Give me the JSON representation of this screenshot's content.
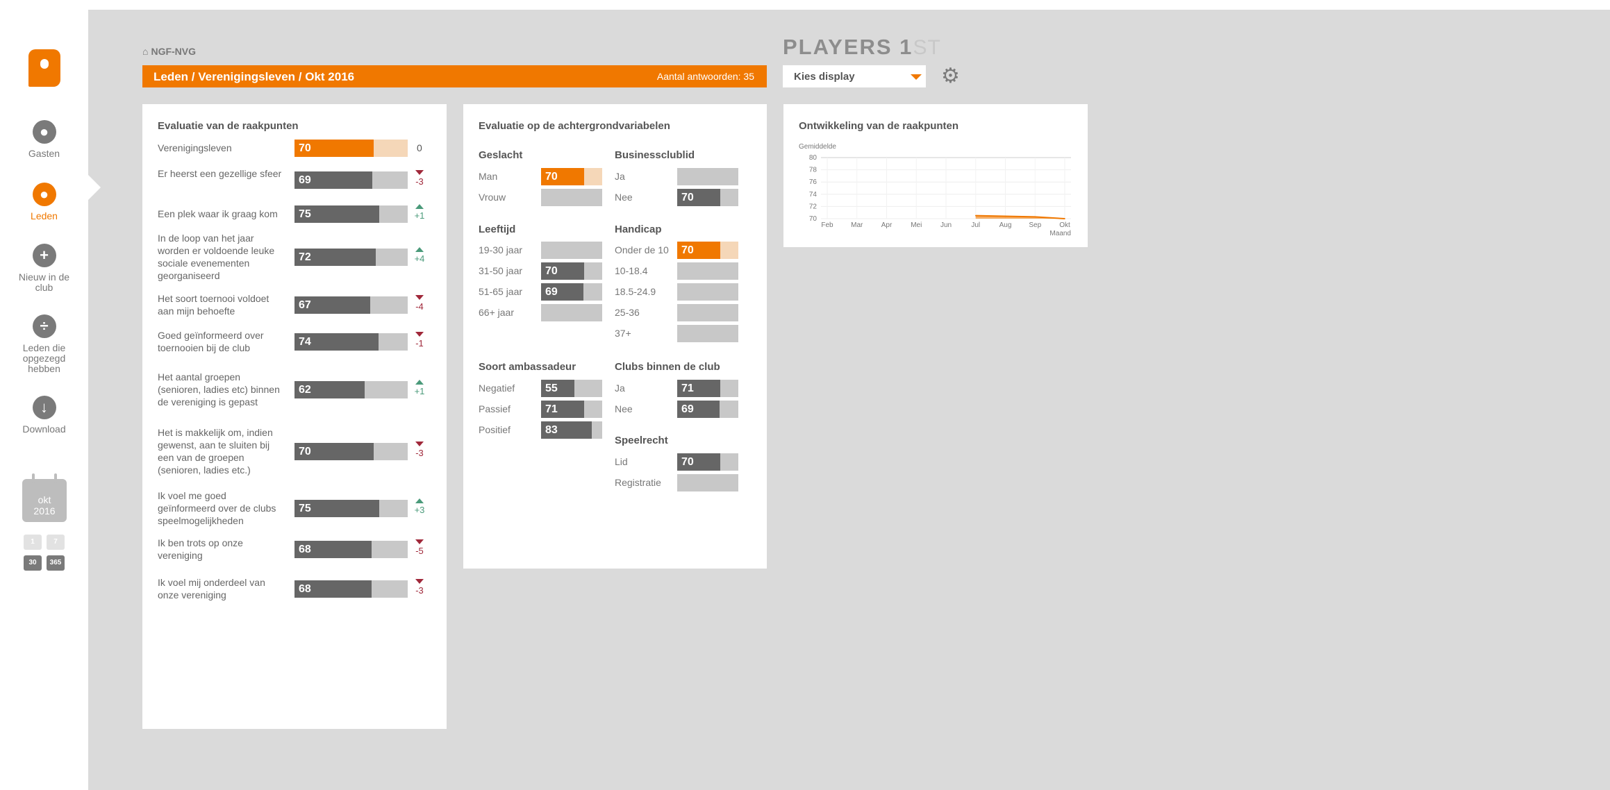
{
  "nav": {
    "items": [
      {
        "label": "Gasten",
        "icon": "person-icon",
        "glyph": "●"
      },
      {
        "label": "Leden",
        "icon": "group-icon",
        "glyph": "●"
      },
      {
        "label": "Nieuw in de club",
        "icon": "plus-icon",
        "glyph": "+"
      },
      {
        "label": "Leden die opgezegd hebben",
        "icon": "divide-icon",
        "glyph": "÷"
      },
      {
        "label": "Download",
        "icon": "download-icon",
        "glyph": "↓"
      }
    ],
    "active_index": 1
  },
  "calendar": {
    "month": "okt",
    "year": "2016",
    "buttons": [
      "1",
      "7",
      "30",
      "365"
    ]
  },
  "header": {
    "org": "NGF-NVG",
    "title": "Leden / Verenigingsleven / Okt 2016",
    "count": "Aantal antwoorden: 35"
  },
  "brand": {
    "name": "PLAYERS 1",
    "sup": "ST"
  },
  "display_select": {
    "label": "Kies display"
  },
  "card1": {
    "title": "Evaluatie van de raakpunten",
    "rows": [
      {
        "label": "Verenigingsleven",
        "value": 70,
        "delta": "0",
        "dir": "none",
        "highlight": true
      },
      {
        "label": "Er heerst een gezellige sfeer",
        "value": 69,
        "delta": "-3",
        "dir": "down"
      },
      {
        "label": "Een plek waar ik graag kom",
        "value": 75,
        "delta": "+1",
        "dir": "up"
      },
      {
        "label": "In de loop van het jaar worden er voldoende leuke sociale evenementen georganiseerd",
        "value": 72,
        "delta": "+4",
        "dir": "up"
      },
      {
        "label": "Het soort toernooi voldoet aan mijn behoefte",
        "value": 67,
        "delta": "-4",
        "dir": "down"
      },
      {
        "label": "Goed geïnformeerd over toernooien bij de club",
        "value": 74,
        "delta": "-1",
        "dir": "down"
      },
      {
        "label": "Het aantal groepen (senioren, ladies etc) binnen de vereniging is gepast",
        "value": 62,
        "delta": "+1",
        "dir": "up"
      },
      {
        "label": "Het is makkelijk om, indien gewenst, aan te sluiten bij een van de groepen (senioren, ladies etc.)",
        "value": 70,
        "delta": "-3",
        "dir": "down"
      },
      {
        "label": "Ik voel me goed geïnformeerd over de clubs speelmogelijkheden",
        "value": 75,
        "delta": "+3",
        "dir": "up"
      },
      {
        "label": "Ik ben trots op onze vereniging",
        "value": 68,
        "delta": "-5",
        "dir": "down"
      },
      {
        "label": "Ik voel mij onderdeel van onze vereniging",
        "value": 68,
        "delta": "-3",
        "dir": "down"
      }
    ]
  },
  "card2": {
    "title": "Evaluatie op de achtergrondvariabelen",
    "sections": {
      "geslacht": {
        "title": "Geslacht",
        "rows": [
          {
            "label": "Man",
            "value": 70,
            "highlight": true
          },
          {
            "label": "Vrouw",
            "value": null
          }
        ]
      },
      "leeftijd": {
        "title": "Leeftijd",
        "rows": [
          {
            "label": "19-30 jaar",
            "value": null
          },
          {
            "label": "31-50 jaar",
            "value": 70
          },
          {
            "label": "51-65 jaar",
            "value": 69
          },
          {
            "label": "66+ jaar",
            "value": null
          }
        ]
      },
      "ambassadeur": {
        "title": "Soort ambassadeur",
        "rows": [
          {
            "label": "Negatief",
            "value": 55
          },
          {
            "label": "Passief",
            "value": 71
          },
          {
            "label": "Positief",
            "value": 83
          }
        ]
      },
      "business": {
        "title": "Businessclublid",
        "rows": [
          {
            "label": "Ja",
            "value": null
          },
          {
            "label": "Nee",
            "value": 70
          }
        ]
      },
      "handicap": {
        "title": "Handicap",
        "rows": [
          {
            "label": "Onder de 10",
            "value": 70,
            "highlight": true
          },
          {
            "label": "10-18.4",
            "value": null
          },
          {
            "label": "18.5-24.9",
            "value": null
          },
          {
            "label": "25-36",
            "value": null
          },
          {
            "label": "37+",
            "value": null
          }
        ]
      },
      "clubs": {
        "title": "Clubs binnen de club",
        "rows": [
          {
            "label": "Ja",
            "value": 71
          },
          {
            "label": "Nee",
            "value": 69
          }
        ]
      },
      "speelrecht": {
        "title": "Speelrecht",
        "rows": [
          {
            "label": "Lid",
            "value": 70
          },
          {
            "label": "Registratie",
            "value": null
          }
        ]
      }
    }
  },
  "card3": {
    "title": "Ontwikkeling van de raakpunten"
  },
  "chart_data": {
    "type": "line",
    "title": "Ontwikkeling van de raakpunten",
    "ylabel": "Gemiddelde",
    "xlabel": "Maand",
    "categories": [
      "Feb",
      "Mar",
      "Apr",
      "Mei",
      "Jun",
      "Jul",
      "Aug",
      "Sep",
      "Okt"
    ],
    "ylim": [
      70,
      80
    ],
    "yticks": [
      80,
      78,
      76,
      74,
      72,
      70
    ],
    "grid": true,
    "series": [
      {
        "values": [
          null,
          null,
          null,
          null,
          null,
          70.5,
          70.4,
          70.3,
          70
        ],
        "color": "#f07800"
      }
    ]
  },
  "colors": {
    "accent": "#f07800",
    "bar_dark": "#666666",
    "bar_light": "#c8c8c8",
    "up": "#4a9a7a",
    "down": "#a0283a"
  }
}
